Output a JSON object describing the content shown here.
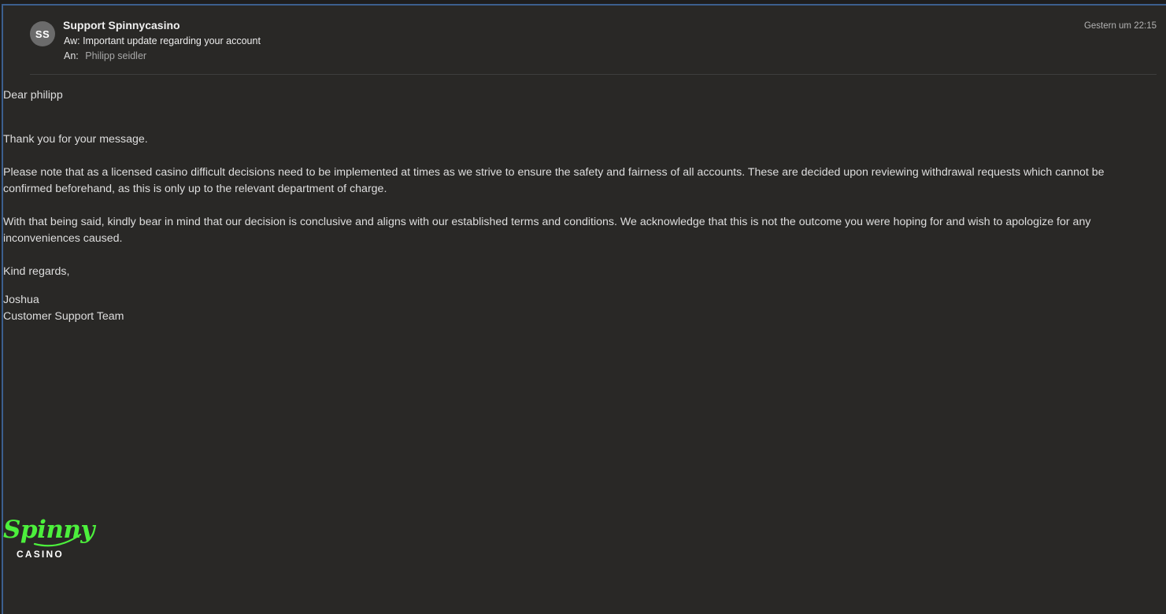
{
  "email": {
    "sender_initials": "SS",
    "sender_name": "Support Spinnycasino",
    "subject": "Aw: Important update regarding your account",
    "to_label": "An:",
    "to_value": "Philipp seidler",
    "timestamp": "Gestern um 22:15"
  },
  "body": {
    "greeting": "Dear philipp",
    "paragraphs": [
      "Thank you for your message.",
      "Please note that as a licensed casino difficult decisions need to be implemented at times as we strive to ensure the safety and fairness of all accounts. These are decided upon reviewing withdrawal requests which cannot be confirmed beforehand, as this is only up to the relevant department of charge.",
      "With that being said, kindly bear in mind that our decision is conclusive and aligns with our established terms and conditions. We acknowledge that this is not the outcome you were hoping for and wish to apologize for any inconveniences caused.",
      "Kind regards,"
    ],
    "signature_name": "Joshua",
    "signature_team": "Customer Support Team"
  },
  "logo": {
    "word": "Spinny",
    "sub": "CASINO",
    "color": "#4cf03c"
  }
}
